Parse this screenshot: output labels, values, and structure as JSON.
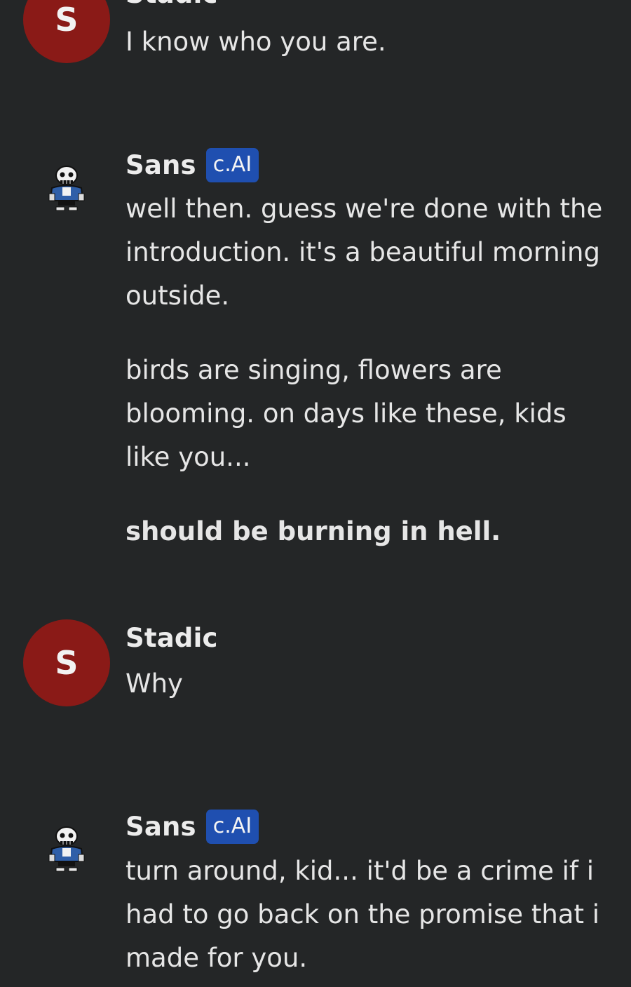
{
  "messages": [
    {
      "sender": "Stadic",
      "avatar_letter": "S",
      "paragraphs": [
        "I know who you are."
      ]
    },
    {
      "sender": "Sans",
      "badge": "c.AI",
      "avatar_icon": "skeleton-sans-icon",
      "paragraphs": [
        "well then. guess we're done with the introduction. it's a beautiful morning outside.",
        "birds are singing, flowers are blooming. on days like these, kids like you...",
        "should be burning in hell."
      ]
    },
    {
      "sender": "Stadic",
      "avatar_letter": "S",
      "paragraphs": [
        "Why"
      ]
    },
    {
      "sender": "Sans",
      "badge": "c.AI",
      "avatar_icon": "skeleton-sans-icon",
      "paragraphs": [
        "turn around, kid... it'd be a crime if i had to go back on the promise that i made for you."
      ]
    }
  ],
  "colors": {
    "background": "#242627",
    "user_avatar": "#8a1a17",
    "badge": "#1f4fb0",
    "text": "#e6e6e6"
  }
}
